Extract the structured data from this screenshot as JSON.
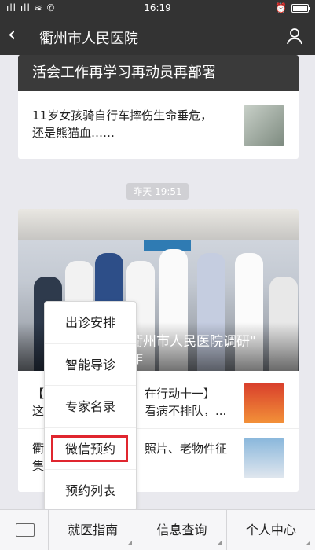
{
  "status": {
    "carrier": "...",
    "time": "16:19",
    "battery_level": 0.9
  },
  "nav": {
    "title": "衢州市人民医院"
  },
  "card1": {
    "banner": "活会工作再学习再动员再部署",
    "item": {
      "line1": "11岁女孩骑自行车摔伤生命垂危，",
      "line2": "还是熊猫血……"
    }
  },
  "timestamp": "昨天 19:51",
  "card2": {
    "photo_caption_line1": "衢州市人民医院调研\"",
    "photo_caption_line2": "作",
    "item1": {
      "line1": "在行动十一】",
      "line2": "看病不排队，...",
      "prefix1": "【",
      "prefix2": "这"
    },
    "item2": {
      "line1": "照片、老物件征",
      "prefix1": "衢",
      "prefix2": "集"
    }
  },
  "popup": {
    "items": [
      "出诊安排",
      "智能导诊",
      "专家名录",
      "微信预约",
      "预约列表"
    ]
  },
  "tabs": [
    "就医指南",
    "信息查询",
    "个人中心"
  ]
}
